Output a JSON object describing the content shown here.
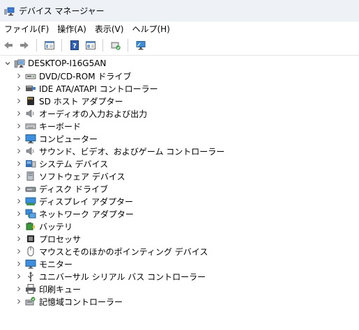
{
  "window": {
    "title": "デバイス マネージャー"
  },
  "menu": [
    "ファイル(F)",
    "操作(A)",
    "表示(V)",
    "ヘルプ(H)"
  ],
  "toolbar_icons": [
    "back-arrow-icon",
    "forward-arrow-icon",
    "properties-icon",
    "help-icon",
    "console-tree-icon",
    "update-driver-icon",
    "monitor-scan-icon"
  ],
  "tree": {
    "root": "DESKTOP-I16G5AN",
    "items": [
      {
        "label": "DVD/CD-ROM ドライブ",
        "icon": "dvd-drive-icon"
      },
      {
        "label": "IDE ATA/ATAPI コントローラー",
        "icon": "ide-controller-icon"
      },
      {
        "label": "SD ホスト アダプター",
        "icon": "sd-host-icon"
      },
      {
        "label": "オーディオの入力および出力",
        "icon": "speaker-icon"
      },
      {
        "label": "キーボード",
        "icon": "keyboard-icon"
      },
      {
        "label": "コンピューター",
        "icon": "computer-icon"
      },
      {
        "label": "サウンド、ビデオ、およびゲーム コントローラー",
        "icon": "speaker-icon"
      },
      {
        "label": "システム デバイス",
        "icon": "system-device-icon"
      },
      {
        "label": "ソフトウェア デバイス",
        "icon": "software-device-icon"
      },
      {
        "label": "ディスク ドライブ",
        "icon": "disk-drive-icon"
      },
      {
        "label": "ディスプレイ アダプター",
        "icon": "display-adapter-icon"
      },
      {
        "label": "ネットワーク アダプター",
        "icon": "network-adapter-icon"
      },
      {
        "label": "バッテリ",
        "icon": "battery-icon"
      },
      {
        "label": "プロセッサ",
        "icon": "processor-icon"
      },
      {
        "label": "マウスとそのほかのポインティング デバイス",
        "icon": "mouse-icon"
      },
      {
        "label": "モニター",
        "icon": "monitor-icon"
      },
      {
        "label": "ユニバーサル シリアル バス コントローラー",
        "icon": "usb-icon"
      },
      {
        "label": "印刷キュー",
        "icon": "printer-icon"
      },
      {
        "label": "記憶域コントローラー",
        "icon": "storage-controller-icon"
      }
    ]
  }
}
